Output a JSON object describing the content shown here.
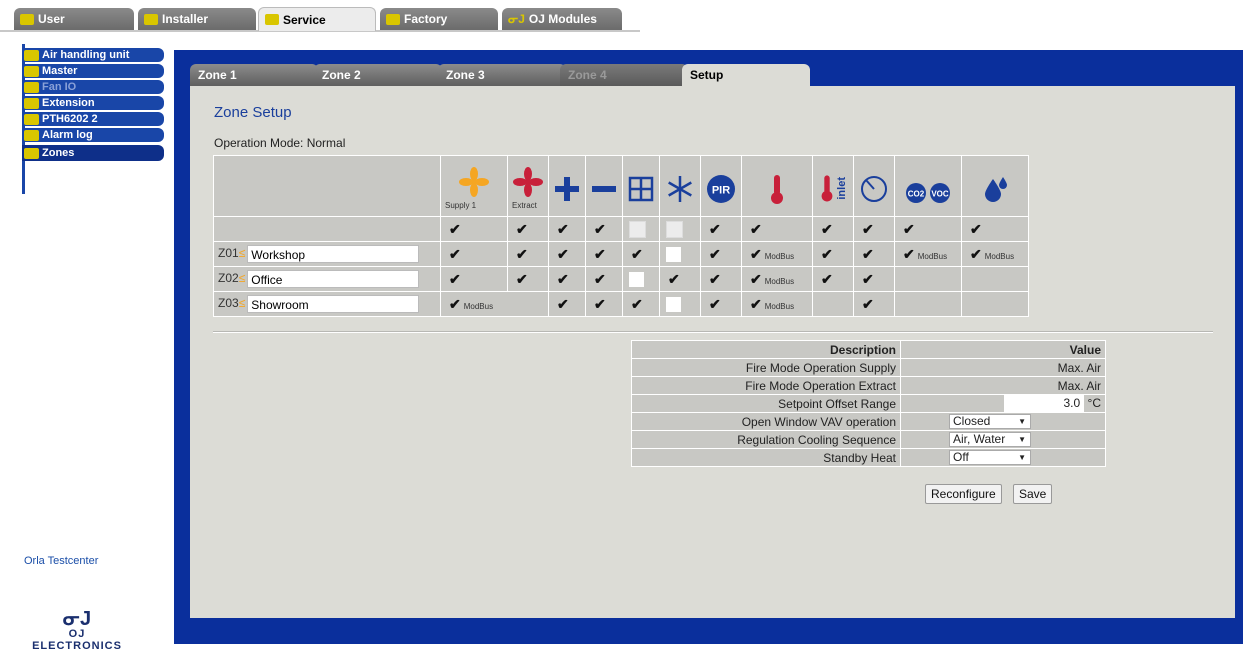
{
  "top_tabs": [
    {
      "label": "User",
      "active": false
    },
    {
      "label": "Installer",
      "active": false
    },
    {
      "label": "Service",
      "active": true
    },
    {
      "label": "Factory",
      "active": false
    },
    {
      "label": "OJ Modules",
      "active": false
    }
  ],
  "sidebar": {
    "items": [
      {
        "label": "Air handling unit"
      },
      {
        "label": "Master"
      },
      {
        "label": "Fan IO"
      },
      {
        "label": "Extension"
      },
      {
        "label": "PTH6202 2"
      },
      {
        "label": "Alarm log"
      },
      {
        "label": "Zones"
      }
    ],
    "testcenter": "Orla Testcenter",
    "logo_text": "OJ ELECTRONICS",
    "logo_mark": "ᓂJ"
  },
  "zone_tabs": [
    {
      "label": "Zone 1"
    },
    {
      "label": "Zone 2"
    },
    {
      "label": "Zone 3"
    },
    {
      "label": "Zone 4"
    },
    {
      "label": "Setup"
    }
  ],
  "page": {
    "title": "Zone Setup",
    "operation_mode": "Operation Mode: Normal"
  },
  "zones_table": {
    "header_labels": {
      "supply": "Supply 1",
      "extract": "Extract",
      "inlet": "inlet",
      "co2": "CO2",
      "voc": "VOC",
      "pir": "PIR"
    },
    "modbus": "ModBus",
    "rows": [
      {
        "id": "Z01",
        "name": "Workshop"
      },
      {
        "id": "Z02",
        "name": "Office"
      },
      {
        "id": "Z03",
        "name": "Showroom"
      }
    ]
  },
  "settings": {
    "header_desc": "Description",
    "header_value": "Value",
    "rows": [
      {
        "desc": "Fire Mode Operation Supply",
        "value": "Max. Air"
      },
      {
        "desc": "Fire Mode Operation Extract",
        "value": "Max. Air"
      },
      {
        "desc": "Setpoint Offset Range",
        "value": "3.0",
        "unit": "°C"
      },
      {
        "desc": "Open Window VAV operation",
        "value": "Closed"
      },
      {
        "desc": "Regulation Cooling Sequence",
        "value": "Air, Water"
      },
      {
        "desc": "Standby Heat",
        "value": "Off"
      }
    ]
  },
  "buttons": {
    "reconfigure": "Reconfigure",
    "save": "Save"
  },
  "colors": {
    "frame": "#0a2f9c",
    "panel": "#dcdcd6",
    "fan_supply": "#f5a623",
    "fan_extract": "#c8203a",
    "icon_blue": "#1a3f9c"
  }
}
